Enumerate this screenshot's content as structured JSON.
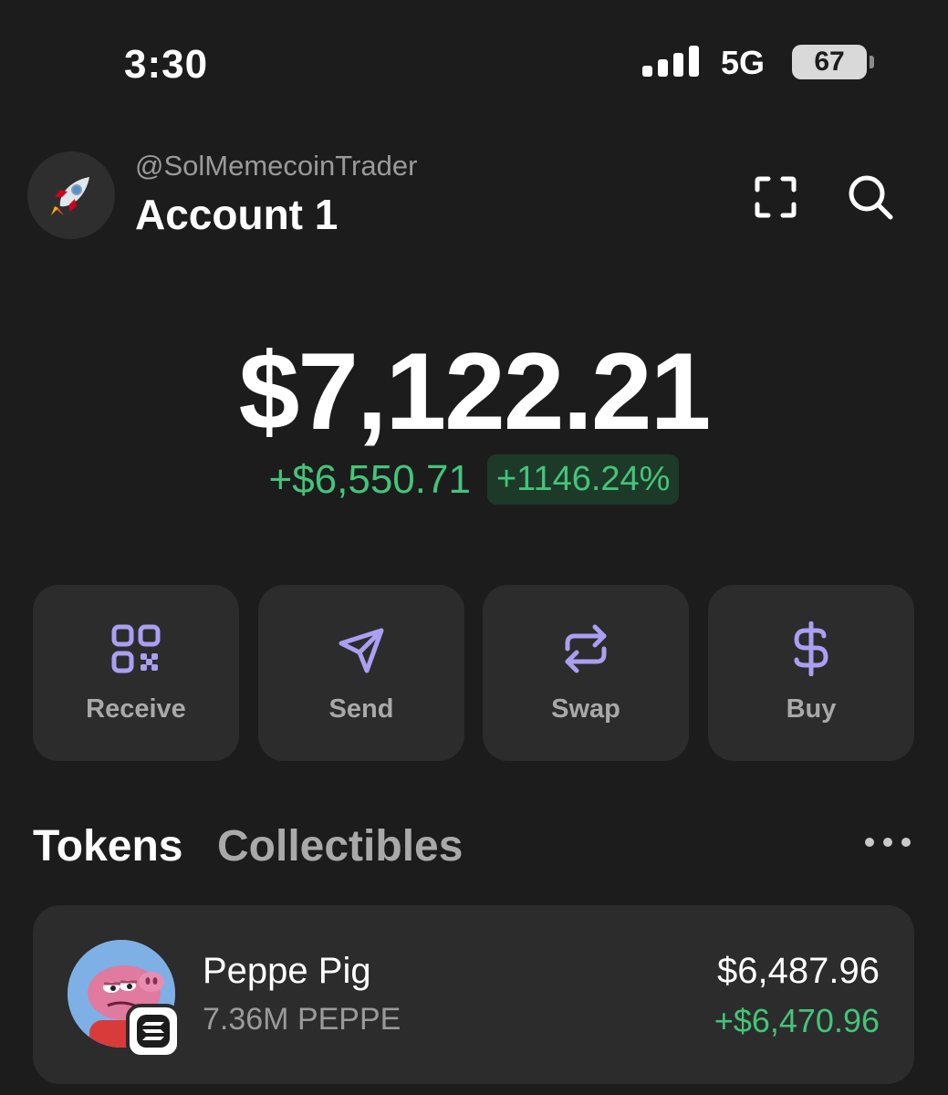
{
  "status_bar": {
    "time": "3:30",
    "network": "5G",
    "battery": "67"
  },
  "account": {
    "handle": "@SolMemecoinTrader",
    "name": "Account 1",
    "avatar_icon": "rocket-icon"
  },
  "portfolio": {
    "balance": "$7,122.21",
    "change_abs": "+$6,550.71",
    "change_pct": "+1146.24%"
  },
  "actions": [
    {
      "label": "Receive",
      "icon": "qr-code-icon"
    },
    {
      "label": "Send",
      "icon": "send-icon"
    },
    {
      "label": "Swap",
      "icon": "swap-icon"
    },
    {
      "label": "Buy",
      "icon": "dollar-icon"
    }
  ],
  "tabs": {
    "tokens": "Tokens",
    "collectibles": "Collectibles"
  },
  "tokens": [
    {
      "name": "Peppe Pig",
      "amount": "7.36M PEPPE",
      "value": "$6,487.96",
      "change": "+$6,470.96"
    }
  ],
  "colors": {
    "background": "#1c1c1c",
    "card": "#2c2c2c",
    "accent": "#ab9ff2",
    "positive": "#44c47a"
  }
}
